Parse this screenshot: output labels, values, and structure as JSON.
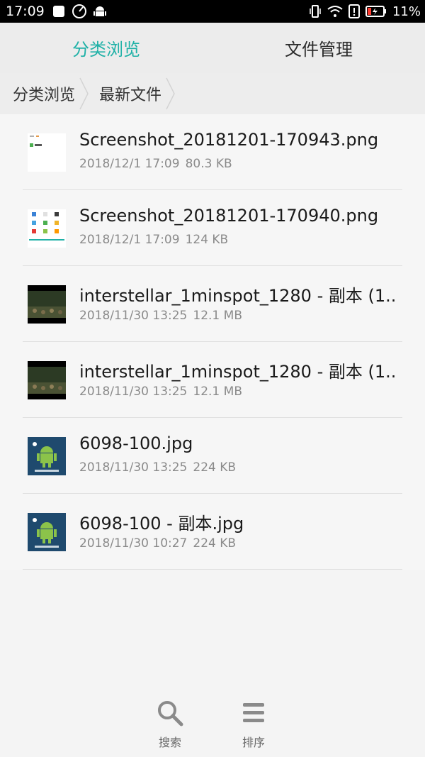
{
  "status_bar": {
    "time": "17:09",
    "battery_text": "11%",
    "icons_left": [
      "stop-icon",
      "speedometer-icon",
      "android-icon"
    ],
    "icons_right": [
      "vibrate-icon",
      "wifi-icon",
      "alert-icon",
      "battery-icon"
    ]
  },
  "tabs": [
    {
      "label": "分类浏览",
      "active": true
    },
    {
      "label": "文件管理",
      "active": false
    }
  ],
  "breadcrumb": [
    "分类浏览",
    "最新文件"
  ],
  "files": [
    {
      "name": "Screenshot_20181201-170943.png",
      "date": "2018/12/1 17:09",
      "size": "80.3 KB",
      "thumb": "screenshot"
    },
    {
      "name": "Screenshot_20181201-170940.png",
      "date": "2018/12/1 17:09",
      "size": "124 KB",
      "thumb": "screenshot-grid"
    },
    {
      "name": "interstellar_1minspot_1280 - 副本 (1..",
      "date": "2018/11/30 13:25",
      "size": "12.1 MB",
      "thumb": "video"
    },
    {
      "name": "interstellar_1minspot_1280 - 副本 (1..",
      "date": "2018/11/30 13:25",
      "size": "12.1 MB",
      "thumb": "video"
    },
    {
      "name": "6098-100.jpg",
      "date": "2018/11/30 13:25",
      "size": "224 KB",
      "thumb": "android-image"
    },
    {
      "name": "6098-100 - 副本.jpg",
      "date": "2018/11/30 10:27",
      "size": "224 KB",
      "thumb": "android-image"
    }
  ],
  "bottom_bar": {
    "search_label": "搜索",
    "sort_label": "排序"
  },
  "colors": {
    "accent": "#1fb1a7",
    "text_primary": "#1a1a1a",
    "text_secondary": "#8a8a8a"
  }
}
